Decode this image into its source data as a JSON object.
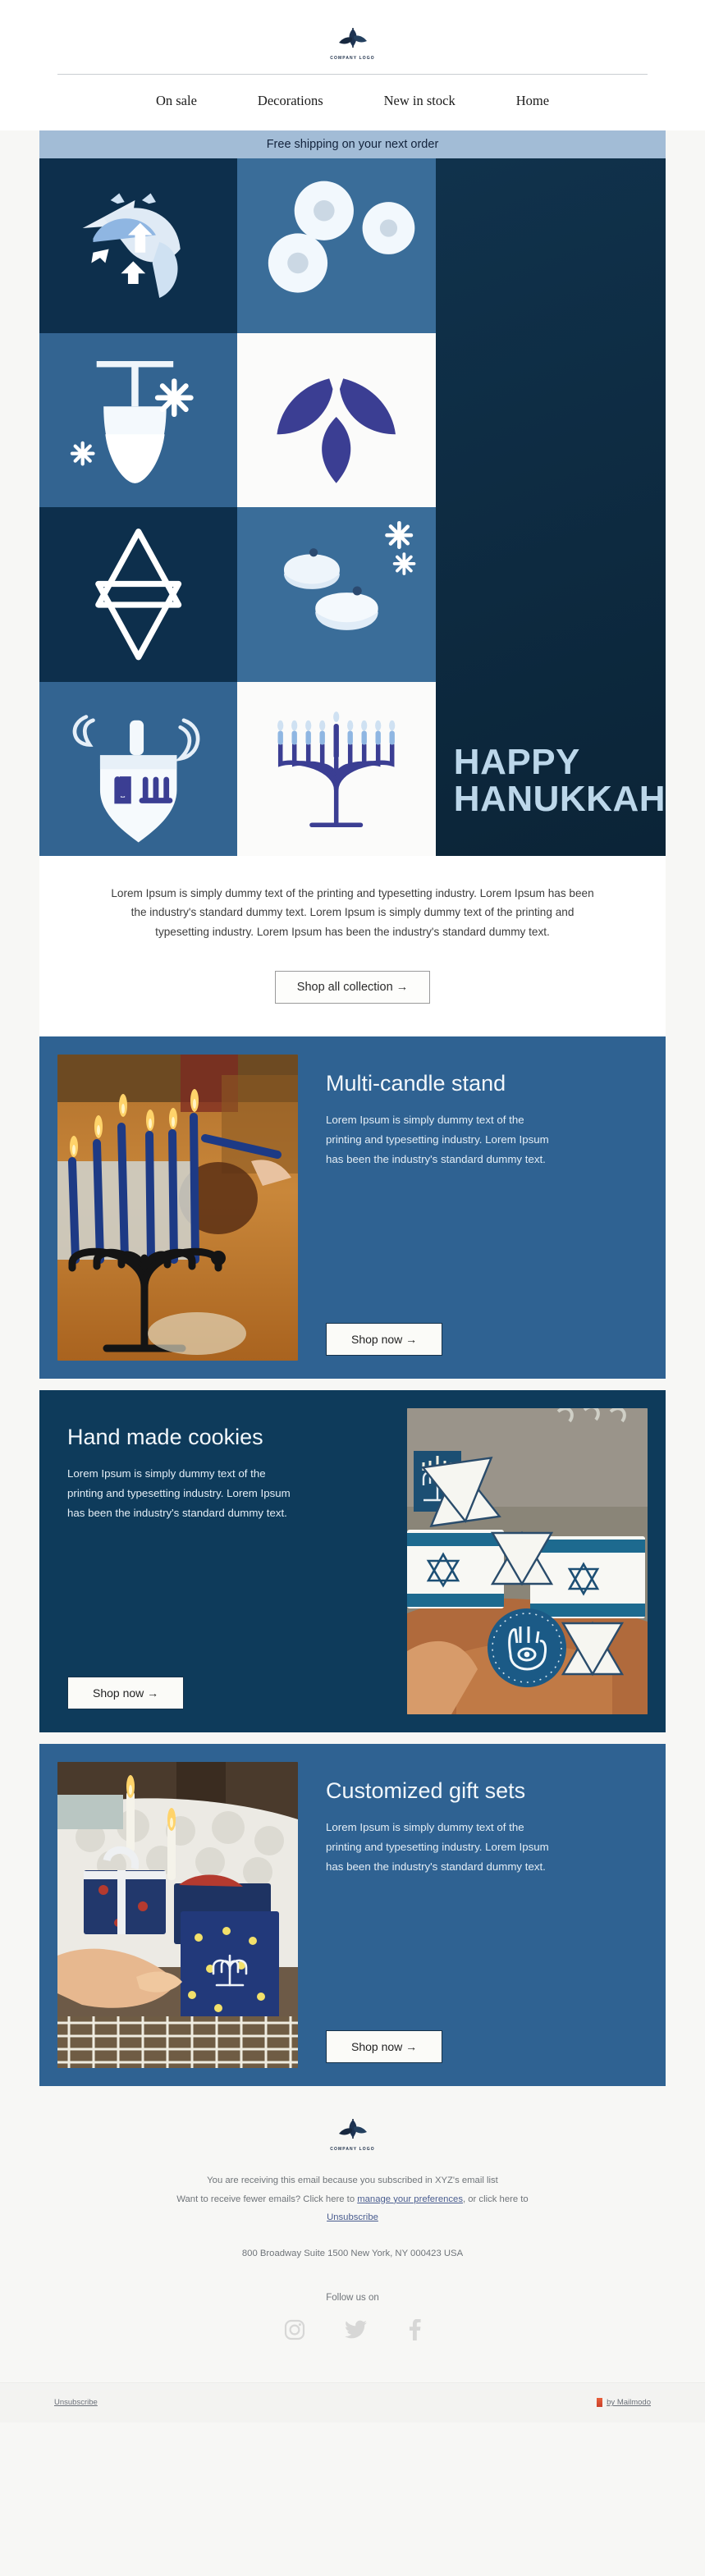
{
  "brand": {
    "logo_text": "COMPANY LOGO",
    "logo_icon": "leaf-logo-icon"
  },
  "nav": {
    "items": [
      {
        "label": "On sale"
      },
      {
        "label": "Decorations"
      },
      {
        "label": "New in stock"
      },
      {
        "label": "Home"
      }
    ]
  },
  "banner": {
    "text": "Free shipping on your next order",
    "bg": "#a2bcd6"
  },
  "hero": {
    "title_line1": "HAPPY",
    "title_line2": "HANUKKAH",
    "title_color": "#bcd7ea",
    "tiles": [
      {
        "icon": "dreidel-spinning-icon",
        "bg": "#0d2f4c"
      },
      {
        "icon": "sufganiyot-donuts-icon",
        "bg": "#3a6d99"
      },
      {
        "icon": "goblet-snowflake-icon",
        "bg": "#336491"
      },
      {
        "icon": "leaf-trio-icon",
        "bg": "#fbfbfa"
      },
      {
        "icon": "star-of-david-icon",
        "bg": "#0d2f4c"
      },
      {
        "icon": "jelly-donuts-sparkle-icon",
        "bg": "#3a6d99"
      },
      {
        "icon": "dreidel-icon",
        "bg": "#336491"
      },
      {
        "icon": "menorah-icon",
        "bg": "#fbfbfa"
      }
    ]
  },
  "intro": {
    "paragraph": "Lorem Ipsum is simply dummy text of the printing and typesetting industry. Lorem Ipsum has been the industry's standard dummy text. Lorem Ipsum is simply dummy text of the printing and typesetting industry. Lorem Ipsum has been the industry's standard dummy text.",
    "cta_label": "Shop all collection  →"
  },
  "products": [
    {
      "title": "Multi-candle stand",
      "body": "Lorem Ipsum is simply dummy text of the printing and typesetting industry. Lorem Ipsum has been the industry's standard dummy text.",
      "cta_label": "Shop now  →",
      "bg": "#2f6292",
      "image_alt": "menorah-with-lit-blue-candles-photo",
      "image_side": "left"
    },
    {
      "title": "Hand made cookies",
      "body": "Lorem Ipsum is simply dummy text of the printing and typesetting industry. Lorem Ipsum has been the industry's standard dummy text.",
      "cta_label": "Shop now  →",
      "bg": "#0e3b5b",
      "image_alt": "star-of-david-and-hamsa-cookies-photo",
      "image_side": "right"
    },
    {
      "title": "Customized gift sets",
      "body": "Lorem Ipsum is simply dummy text of the printing and typesetting industry. Lorem Ipsum has been the industry's standard dummy text.",
      "cta_label": "Shop now  →",
      "bg": "#2f6292",
      "image_alt": "wrapped-hanukkah-gift-boxes-photo",
      "image_side": "left"
    }
  ],
  "footer": {
    "line1": "You are receiving this email because you subscribed in XYZ's email list",
    "line2_a": "Want to receive fewer emails? Click here to ",
    "line2_link": "manage your preferences",
    "line2_b": ", or click here to",
    "line3_link": "Unsubscribe",
    "address": "800 Broadway Suite 1500 New York, NY 000423  USA",
    "follow_label": "Follow us on",
    "social": [
      {
        "name": "instagram-icon"
      },
      {
        "name": "twitter-icon"
      },
      {
        "name": "facebook-icon"
      }
    ]
  },
  "bottombar": {
    "unsubscribe": "Unsubscribe",
    "powered_by": "by Mailmodo"
  }
}
